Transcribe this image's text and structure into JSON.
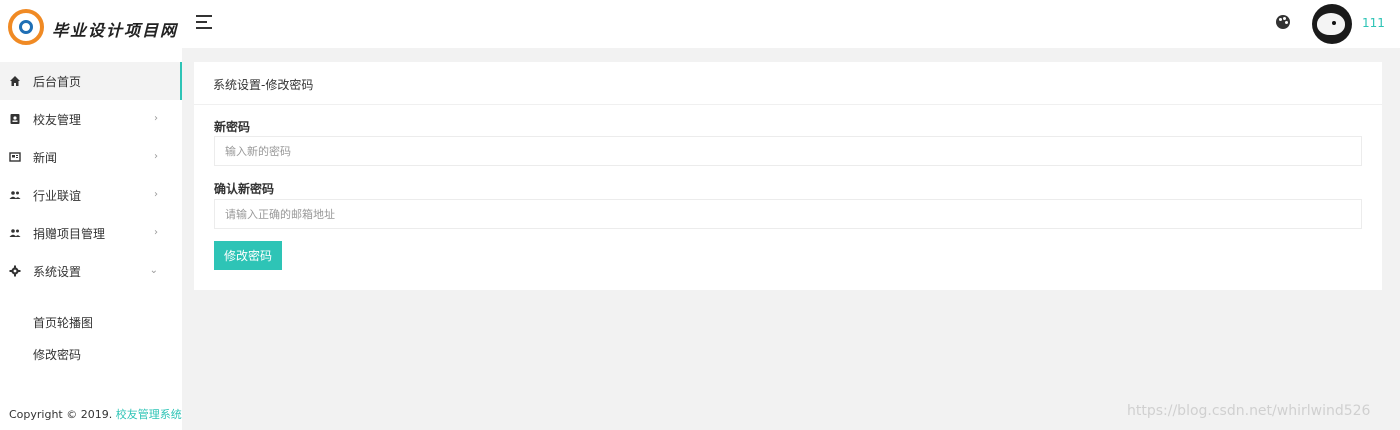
{
  "logo": {
    "text": "毕业设计项目网"
  },
  "sidebar": {
    "items": [
      {
        "label": "后台首页",
        "icon": "home-icon"
      },
      {
        "label": "校友管理",
        "icon": "contacts-icon"
      },
      {
        "label": "新闻",
        "icon": "news-icon"
      },
      {
        "label": "行业联谊",
        "icon": "group-icon"
      },
      {
        "label": "捐赠项目管理",
        "icon": "group-icon"
      },
      {
        "label": "系统设置",
        "icon": "gear-icon"
      }
    ],
    "sub_items": [
      {
        "label": "首页轮播图"
      },
      {
        "label": "修改密码"
      }
    ],
    "copyright": {
      "prefix": "Copyright © 2019.",
      "link": "校友管理系统"
    }
  },
  "header": {
    "username": "111"
  },
  "form": {
    "title": "系统设置-修改密码",
    "new_password": {
      "label": "新密码",
      "placeholder": "输入新的密码"
    },
    "confirm_password": {
      "label": "确认新密码",
      "placeholder": "请输入正确的邮箱地址"
    },
    "submit_label": "修改密码"
  },
  "watermark": "https://blog.csdn.net/whirlwind526",
  "colors": {
    "accent": "#2ec4b6",
    "background": "#f2f2f2"
  }
}
